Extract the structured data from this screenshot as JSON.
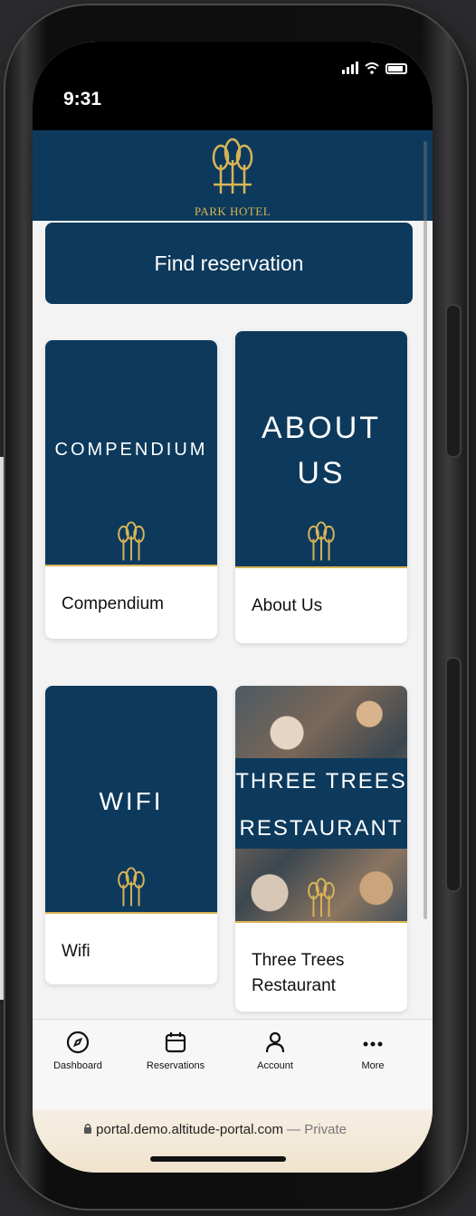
{
  "status_bar": {
    "time": "9:31"
  },
  "header": {
    "hotel_name": "PARK HOTEL",
    "accent_color": "#d8b456",
    "brand_color": "#0d3a5c"
  },
  "main": {
    "find_reservation_label": "Find reservation",
    "tiles": [
      {
        "art_title": "COMPENDIUM",
        "caption": "Compendium"
      },
      {
        "art_title_line1": "ABOUT",
        "art_title_line2": "US",
        "caption": "About Us"
      },
      {
        "art_title": "WIFI",
        "caption": "Wifi"
      },
      {
        "art_title_line1": "THREE TREES",
        "art_title_line2": "RESTAURANT",
        "caption": "Three Trees Restaurant"
      }
    ]
  },
  "tabbar": {
    "items": [
      {
        "label": "Dashboard",
        "icon": "compass-icon"
      },
      {
        "label": "Reservations",
        "icon": "calendar-icon"
      },
      {
        "label": "Account",
        "icon": "person-icon"
      },
      {
        "label": "More",
        "icon": "more-dots-icon"
      }
    ]
  },
  "browser": {
    "url": "portal.demo.altitude-portal.com",
    "mode": "— Private"
  }
}
